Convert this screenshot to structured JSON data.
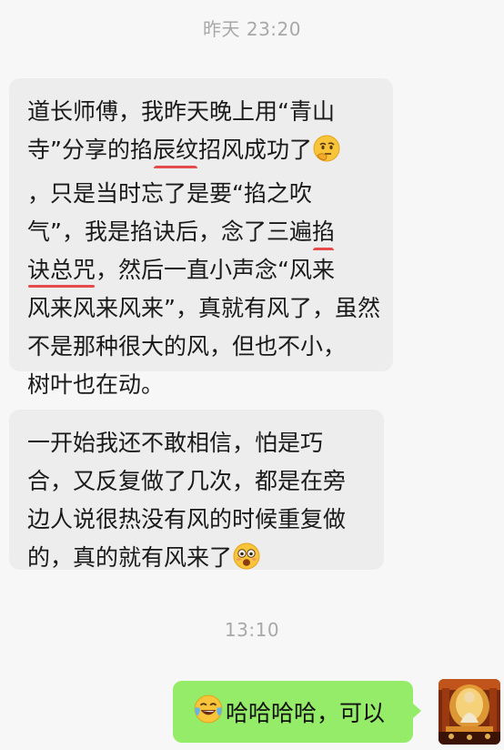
{
  "chat": {
    "timestamps": [
      "昨天 23:20",
      "13:10"
    ],
    "msg1": {
      "line1": "道长师傅，我昨天晚上用“青山",
      "line2_a": "寺”分享的掐",
      "line2_hl": "辰纹",
      "line2_b": "招风成功了",
      "line3": "，只是当时忘了是要“掐之吹",
      "line4_a": "气”，我是掐诀后，念了三遍",
      "line4_hl": "掐",
      "line5_hl": "诀总咒",
      "line5_b": "，然后一直小声念“风来",
      "line6": "风来风来风来”，真就有风了，虽然",
      "line7": "不是那种很大的风，但也不小，",
      "line8": "树叶也在动。",
      "emoji": "thinking-face"
    },
    "msg2": {
      "line1": "一开始我还不敢相信，怕是巧",
      "line2": "合，又反复做了几次，都是在旁",
      "line3": "边人说很热没有风的时候重复做",
      "line4": "的，真的就有风来了",
      "emoji": "flushed-face"
    },
    "reply": {
      "text": "哈哈哈哈，可以",
      "emoji": "tears-of-joy-face"
    }
  },
  "colors": {
    "page_bg": "#f7f7f7",
    "incoming_bubble": "#ededed",
    "outgoing_bubble": "#95ec69",
    "underline": "#e64b4b",
    "timestamp": "#a8a8a8"
  }
}
